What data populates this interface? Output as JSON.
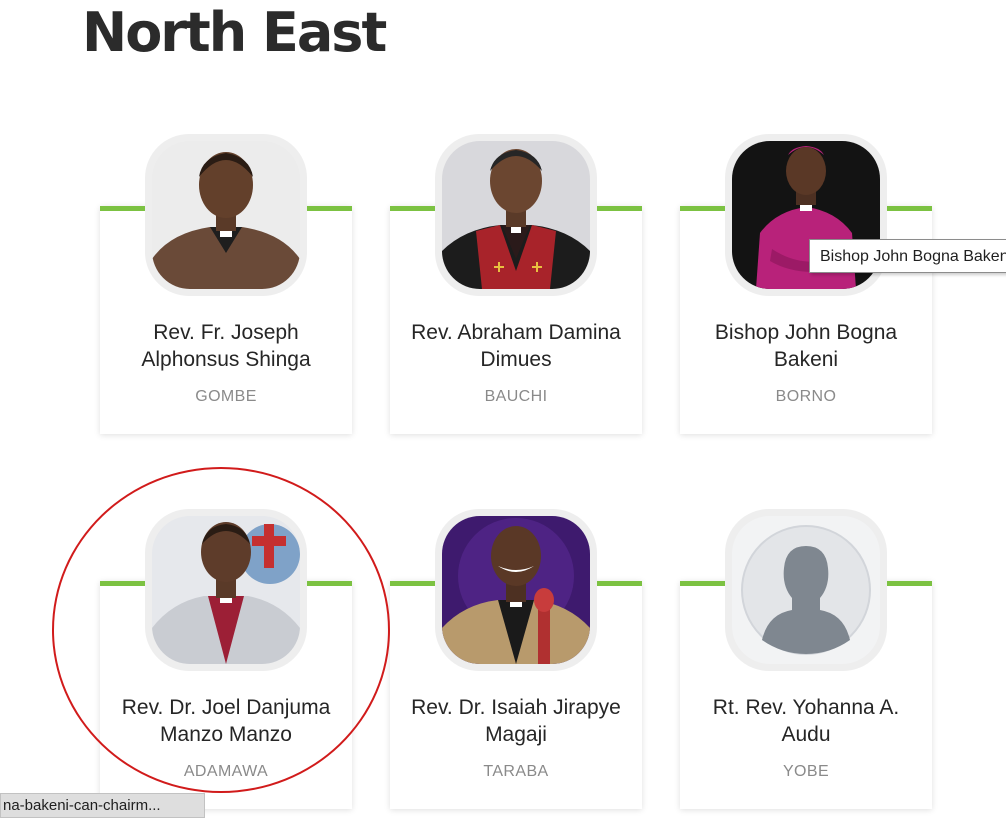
{
  "section": {
    "title": "North East"
  },
  "people": [
    {
      "name": "Rev. Fr. Joseph Alphonsus Shinga",
      "state": "GOMBE"
    },
    {
      "name": "Rev. Abraham Damina Dimues",
      "state": "BAUCHI"
    },
    {
      "name": "Bishop John Bogna Bakeni",
      "state": "BORNO"
    },
    {
      "name": "Rev. Dr. Joel Danjuma Manzo Manzo",
      "state": "ADAMAWA"
    },
    {
      "name": "Rev. Dr. Isaiah Jirapye Magaji",
      "state": "TARABA"
    },
    {
      "name": "Rt. Rev. Yohanna A. Audu",
      "state": "YOBE"
    }
  ],
  "tooltip": {
    "text": "Bishop John Bogna Bakeni"
  },
  "status_bar": {
    "url_text": "na-bakeni-can-chairm..."
  },
  "colors": {
    "accent_green": "#7cc242",
    "highlight_red": "#d11b1b",
    "state_gray": "#8a8a8a"
  },
  "icons": {
    "placeholder_avatar": "user-silhouette-icon"
  }
}
